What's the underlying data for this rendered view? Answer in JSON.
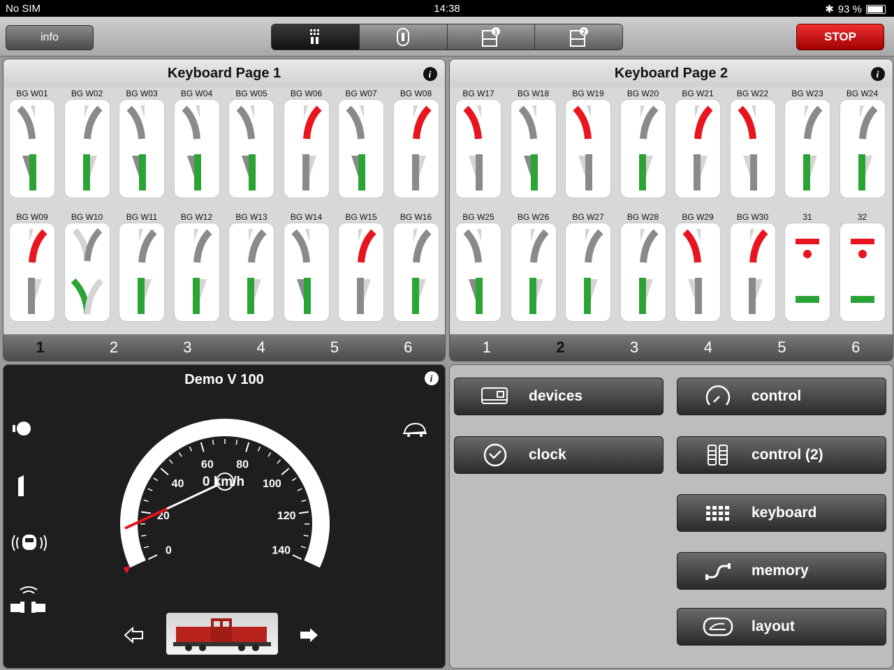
{
  "status": {
    "carrier": "No SIM",
    "time": "14:38",
    "battery": "93 %"
  },
  "toolbar": {
    "info_label": "info",
    "stop_label": "STOP",
    "segments": [
      "keyboard-icon",
      "controller-icon",
      "memory-1-icon",
      "memory-2-icon"
    ],
    "active_segment": 0
  },
  "keyboards": [
    {
      "title": "Keyboard Page 1",
      "current_page": 1,
      "pages": [
        "1",
        "2",
        "3",
        "4",
        "5",
        "6"
      ],
      "cells": [
        {
          "label": "BG W01",
          "type": "left",
          "active": "straight"
        },
        {
          "label": "BG W02",
          "type": "right",
          "active": "straight"
        },
        {
          "label": "BG W03",
          "type": "left",
          "active": "straight"
        },
        {
          "label": "BG W04",
          "type": "left",
          "active": "straight"
        },
        {
          "label": "BG W05",
          "type": "left",
          "active": "straight"
        },
        {
          "label": "BG W06",
          "type": "right",
          "active": "curve"
        },
        {
          "label": "BG W07",
          "type": "left",
          "active": "straight"
        },
        {
          "label": "BG W08",
          "type": "right",
          "active": "curve"
        },
        {
          "label": "BG W09",
          "type": "right",
          "active": "curve"
        },
        {
          "label": "BG W10",
          "type": "y",
          "active": "curve"
        },
        {
          "label": "BG W11",
          "type": "right",
          "active": "straight"
        },
        {
          "label": "BG W12",
          "type": "right",
          "active": "straight"
        },
        {
          "label": "BG W13",
          "type": "right",
          "active": "straight"
        },
        {
          "label": "BG W14",
          "type": "left",
          "active": "straight"
        },
        {
          "label": "BG W15",
          "type": "right",
          "active": "curve"
        },
        {
          "label": "BG W16",
          "type": "right",
          "active": "straight"
        }
      ]
    },
    {
      "title": "Keyboard Page 2",
      "current_page": 2,
      "pages": [
        "1",
        "2",
        "3",
        "4",
        "5",
        "6"
      ],
      "cells": [
        {
          "label": "BG W17",
          "type": "left",
          "active": "curve"
        },
        {
          "label": "BG W18",
          "type": "left",
          "active": "straight"
        },
        {
          "label": "BG W19",
          "type": "left",
          "active": "curve"
        },
        {
          "label": "BG W20",
          "type": "right",
          "active": "straight"
        },
        {
          "label": "BG W21",
          "type": "right",
          "active": "curve"
        },
        {
          "label": "BG W22",
          "type": "left",
          "active": "curve"
        },
        {
          "label": "BG W23",
          "type": "right",
          "active": "straight"
        },
        {
          "label": "BG W24",
          "type": "right",
          "active": "straight"
        },
        {
          "label": "BG W25",
          "type": "left",
          "active": "straight"
        },
        {
          "label": "BG W26",
          "type": "right",
          "active": "straight"
        },
        {
          "label": "BG W27",
          "type": "right",
          "active": "straight"
        },
        {
          "label": "BG W28",
          "type": "right",
          "active": "straight"
        },
        {
          "label": "BG W29",
          "type": "left",
          "active": "curve"
        },
        {
          "label": "BG W30",
          "type": "right",
          "active": "curve"
        },
        {
          "label": "31",
          "type": "signal",
          "active": "go"
        },
        {
          "label": "32",
          "type": "signal",
          "active": "go"
        }
      ]
    }
  ],
  "loco": {
    "name": "Demo V 100",
    "speed_text": "0 km/h",
    "speed": 0,
    "max_speed": 140,
    "dial_ticks": [
      "0",
      "20",
      "40",
      "60",
      "80",
      "100",
      "120",
      "140"
    ],
    "functions": [
      "headlight-icon",
      "shunting-icon",
      "horn-icon",
      "coupler-icon"
    ]
  },
  "menu": {
    "buttons": [
      {
        "label": "devices",
        "icon": "devices-icon"
      },
      {
        "label": "control",
        "icon": "control-gauge-icon"
      },
      {
        "label": "clock",
        "icon": "clock-icon"
      },
      {
        "label": "control (2)",
        "icon": "dual-control-icon"
      },
      {
        "label": "keyboard",
        "icon": "keyboard-icon"
      },
      {
        "label": "memory",
        "icon": "memory-route-icon"
      },
      {
        "label": "layout",
        "icon": "layout-icon"
      }
    ]
  },
  "colors": {
    "red": "#e8141e",
    "green": "#2ba436",
    "gray": "#8a8a8a",
    "lightgray": "#d4d4d4"
  }
}
